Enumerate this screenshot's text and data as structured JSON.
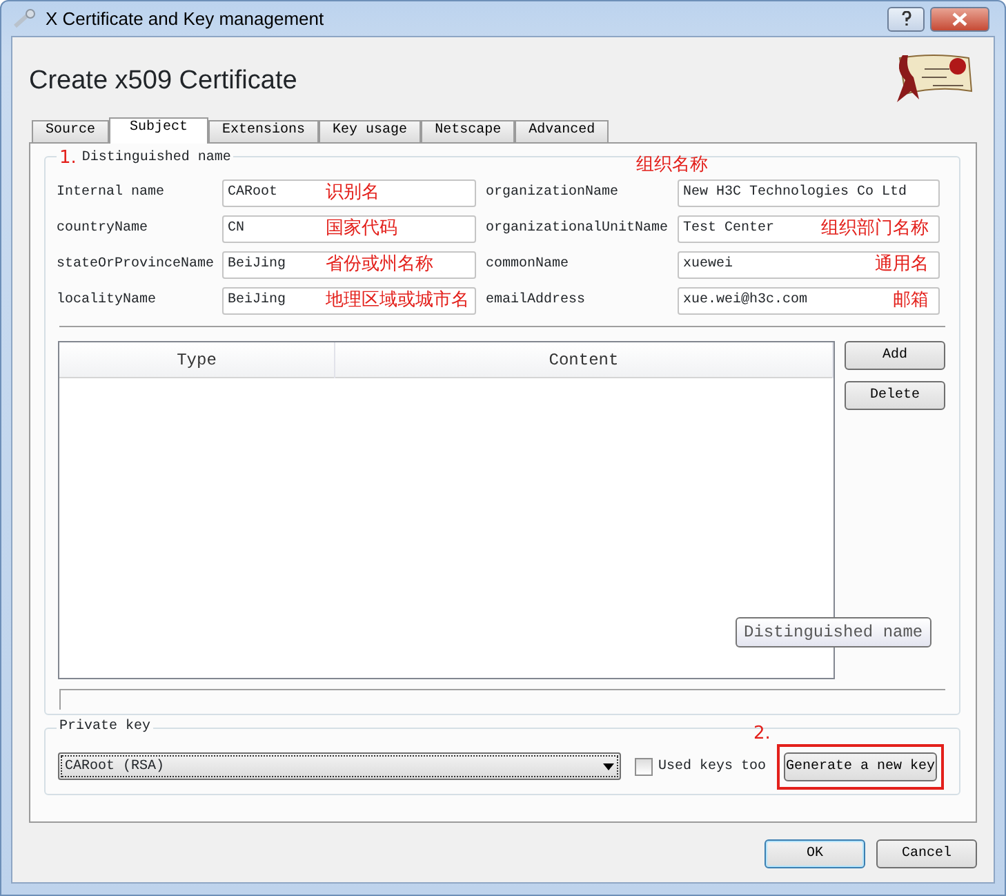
{
  "window": {
    "title": "X Certificate and Key management"
  },
  "heading": "Create x509 Certificate",
  "tabs": [
    {
      "label": "Source",
      "selected": false
    },
    {
      "label": "Subject",
      "selected": true
    },
    {
      "label": "Extensions",
      "selected": false
    },
    {
      "label": "Key usage",
      "selected": false
    },
    {
      "label": "Netscape",
      "selected": false
    },
    {
      "label": "Advanced",
      "selected": false
    }
  ],
  "distinguished_name": {
    "annotation": "1.",
    "title": "Distinguished name",
    "header_annotation": "组织名称",
    "fields": [
      {
        "label": "Internal name",
        "value": "CARoot",
        "annotation": "识别名"
      },
      {
        "label": "organizationName",
        "value": "New H3C Technologies Co Ltd"
      },
      {
        "label": "countryName",
        "value": "CN",
        "annotation": "国家代码"
      },
      {
        "label": "organizationalUnitName",
        "value": "Test Center",
        "annotation": "组织部门名称"
      },
      {
        "label": "stateOrProvinceName",
        "value": "BeiJing",
        "annotation": "省份或州名称"
      },
      {
        "label": "commonName",
        "value": "xuewei",
        "annotation": "通用名"
      },
      {
        "label": "localityName",
        "value": "BeiJing",
        "annotation": "地理区域或城市名"
      },
      {
        "label": "emailAddress",
        "value": "xue.wei@h3c.com",
        "annotation": "邮箱"
      }
    ]
  },
  "table": {
    "columns": [
      "Type",
      "Content"
    ],
    "buttons": [
      "Add",
      "Delete"
    ],
    "tooltip": "Distinguished name"
  },
  "private_key": {
    "title": "Private key",
    "key": "CARoot (RSA)",
    "used_keys_too": {
      "label": "Used keys too",
      "checked": false
    },
    "annotation": "2.",
    "generate_button": "Generate a new key",
    "highlighted": true
  },
  "buttons": [
    {
      "label": "OK",
      "default": true
    },
    {
      "label": "Cancel",
      "default": false
    }
  ]
}
